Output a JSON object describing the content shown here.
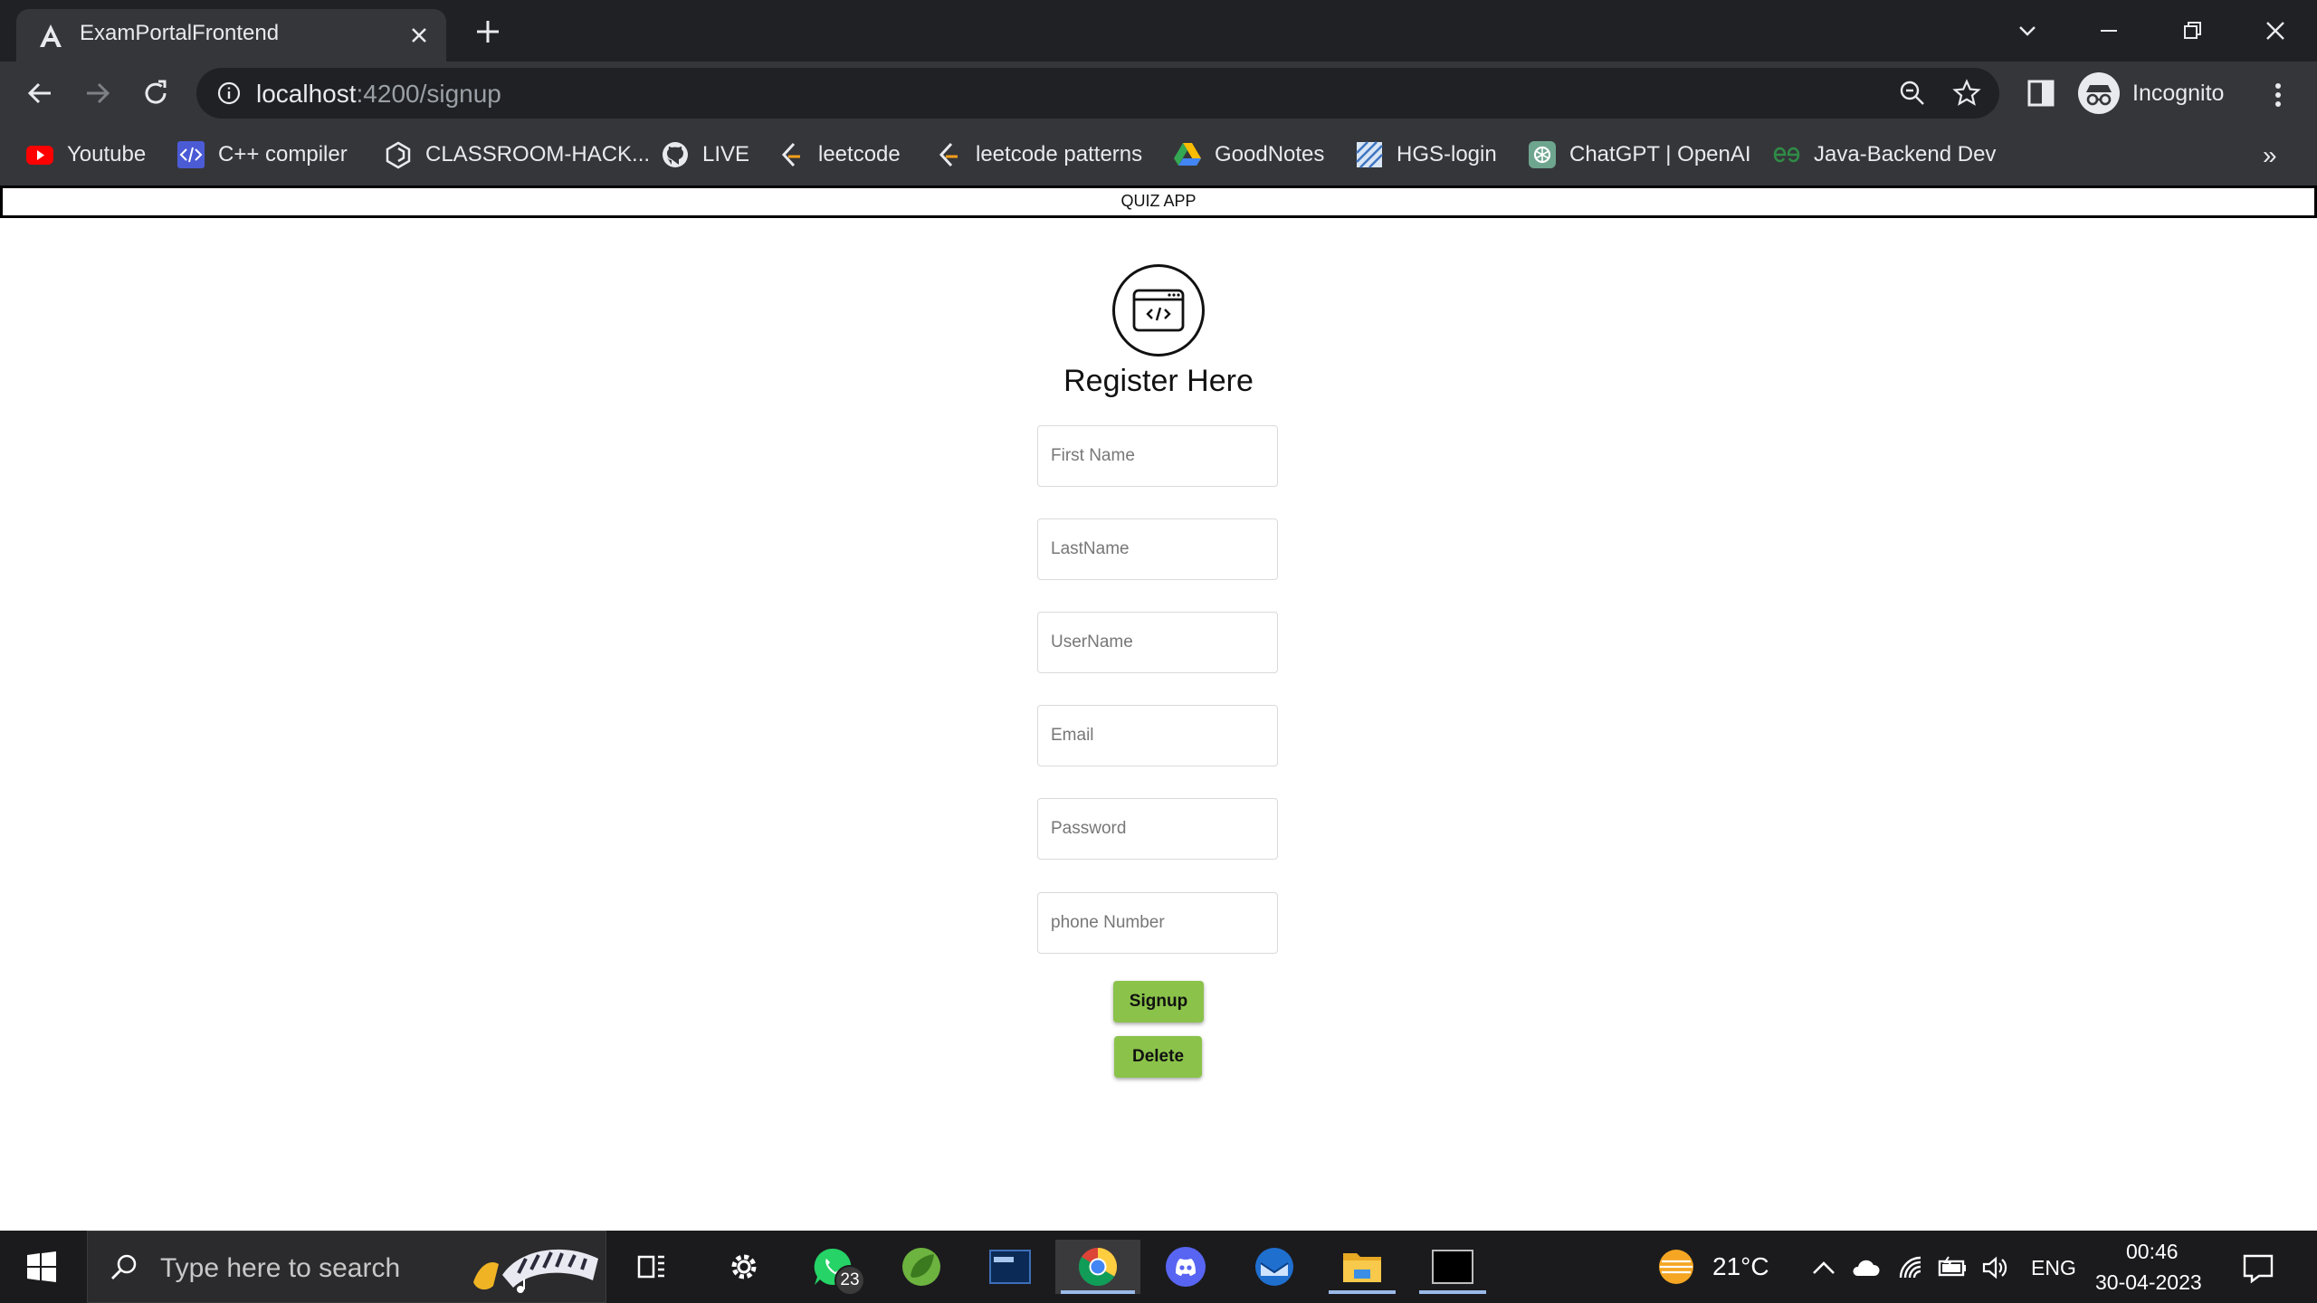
{
  "browser": {
    "tab_title": "ExamPortalFrontend",
    "url_host": "localhost",
    "url_rest": ":4200/signup",
    "profile_label": "Incognito",
    "bookmarks": [
      {
        "label": "Youtube",
        "icon": "youtube-icon"
      },
      {
        "label": "C++ compiler",
        "icon": "code-icon"
      },
      {
        "label": "CLASSROOM-HACK...",
        "icon": "hexagon-icon"
      },
      {
        "label": "LIVE",
        "icon": "github-icon"
      },
      {
        "label": "leetcode",
        "icon": "leetcode-icon"
      },
      {
        "label": "leetcode patterns",
        "icon": "leetcode-icon"
      },
      {
        "label": "GoodNotes",
        "icon": "drive-icon"
      },
      {
        "label": "HGS-login",
        "icon": "hgs-icon"
      },
      {
        "label": "ChatGPT | OpenAI",
        "icon": "openai-icon"
      },
      {
        "label": "Java-Backend Dev",
        "icon": "gfg-icon"
      }
    ],
    "bookmarks_more": "»"
  },
  "app": {
    "navbar_title": "QUIZ APP",
    "form_title": "Register Here",
    "fields": {
      "first_name": "First Name",
      "last_name": "LastName",
      "username": "UserName",
      "email": "Email",
      "password": "Password",
      "phone": "phone Number"
    },
    "signup_label": "Signup",
    "delete_label": "Delete",
    "button_color": "#8bc34a"
  },
  "taskbar": {
    "search_placeholder": "Type here to search",
    "whatsapp_badge": "23",
    "weather_temp": "21°C",
    "language": "ENG",
    "time": "00:46",
    "date": "30-04-2023"
  }
}
